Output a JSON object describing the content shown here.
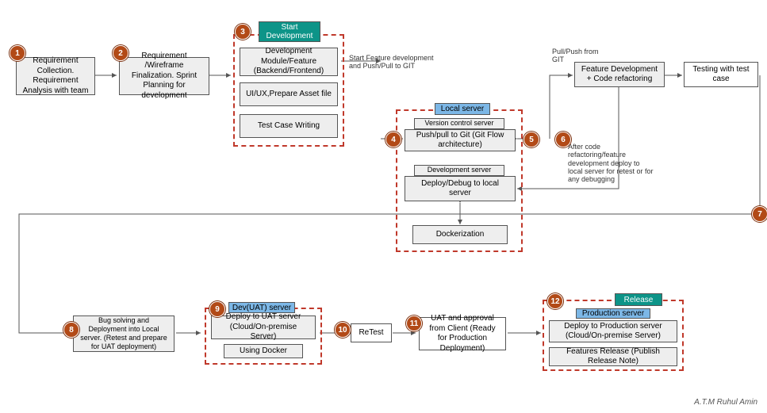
{
  "steps": {
    "s1": "1",
    "s2": "2",
    "s3": "3",
    "s4": "4",
    "s5": "5",
    "s6": "6",
    "s7": "7",
    "s8": "8",
    "s9": "9",
    "s10": "10",
    "s11": "11",
    "s12": "12"
  },
  "boxes": {
    "req_collection": "Requirement Collection.\nRequirement Analysis with team",
    "wireframe": "Requirement /Wireframe Finalization. Sprint Planning for development",
    "dev_module": "Development Module/Feature\n(Backend/Frontend)",
    "uiux": "UI/UX,Prepare Asset file",
    "testcase": "Test Case Writing",
    "vcs_hdr": "Version control server",
    "git": "Push/pull to Git\n(Git Flow architecture)",
    "dev_hdr": "Development server",
    "deploy_local": "Deploy/Debug to local server",
    "docker": "Dockerization",
    "feature_dev": "Feature Development + Code refactoring",
    "testing": "Testing with test case",
    "bug_solving": "Bug solving and Deployment into Local server. (Retest and prepare for UAT deployment)",
    "deploy_uat": "Deploy to UAT server\n(Cloud/On-premise Server)",
    "using_docker": "Using Docker",
    "retest": "ReTest",
    "uat_approval": "UAT and approval from Client\n(Ready for Production Deployment)",
    "deploy_prod": "Deploy to Production server\n(Cloud/On-premise Server)",
    "features_release": "Features Release\n(Publish Release Note)"
  },
  "banners": {
    "start_dev": "Start Development",
    "local_server": "Local server",
    "dev_uat": "Dev(UAT) server",
    "release": "Release",
    "prod_server": "Production server"
  },
  "labels": {
    "start_feature": "Start Feature development and Push/Pull to GIT",
    "pull_push": "Pull/Push from GIT",
    "after_refactor": "After code refactoring/feature development deploy to local server for retest or for any debugging"
  },
  "credit": "A.T.M Ruhul Amin"
}
